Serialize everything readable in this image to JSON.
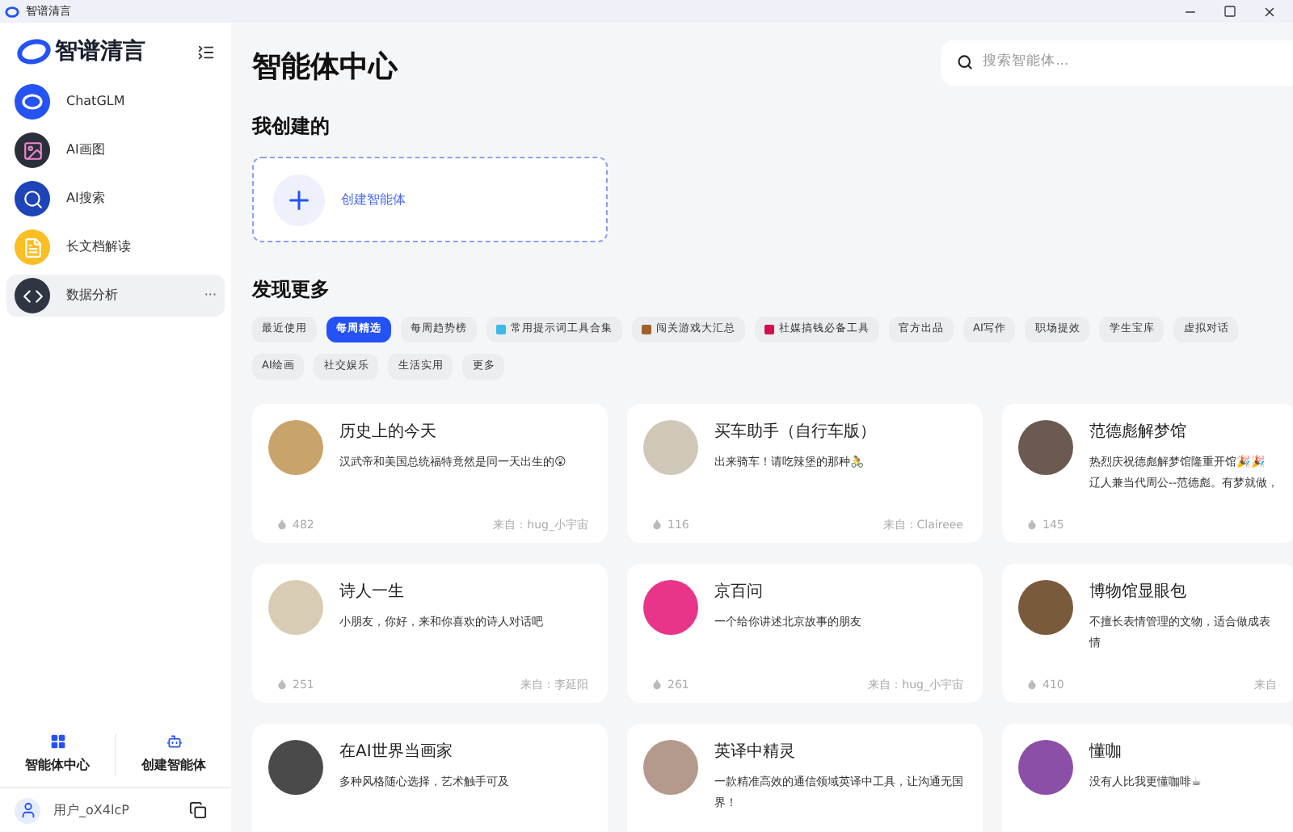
{
  "window": {
    "title": "智谱清言"
  },
  "sidebar": {
    "brand": "智谱清言",
    "items": [
      {
        "label": "ChatGLM",
        "kind": "chatglm",
        "selected": false
      },
      {
        "label": "AI画图",
        "kind": "draw",
        "selected": false
      },
      {
        "label": "AI搜索",
        "kind": "search",
        "selected": false
      },
      {
        "label": "长文档解读",
        "kind": "doc",
        "selected": false
      },
      {
        "label": "数据分析",
        "kind": "code",
        "selected": true,
        "more": "···"
      }
    ],
    "bottom_actions": [
      {
        "label": "智能体中心",
        "kind": "grid"
      },
      {
        "label": "创建智能体",
        "kind": "create"
      }
    ],
    "user": {
      "name": "用户_oX4lcP"
    }
  },
  "page": {
    "title": "智能体中心",
    "search": {
      "placeholder": "搜索智能体..."
    },
    "my_section": {
      "title": "我创建的",
      "create_label": "创建智能体"
    },
    "discover": {
      "title": "发现更多",
      "tags": [
        {
          "label": "最近使用",
          "selected": false
        },
        {
          "label": "每周精选",
          "selected": true
        },
        {
          "label": "每周趋势榜",
          "selected": false
        },
        {
          "label": "常用提示词工具合集",
          "selected": false,
          "color": "#3fb7e8"
        },
        {
          "label": "闯关游戏大汇总",
          "selected": false,
          "color": "#a0622a"
        },
        {
          "label": "社媒搞钱必备工具",
          "selected": false,
          "color": "#d0104c"
        },
        {
          "label": "官方出品",
          "selected": false
        },
        {
          "label": "AI写作",
          "selected": false
        },
        {
          "label": "职场提效",
          "selected": false
        },
        {
          "label": "学生宝库",
          "selected": false
        },
        {
          "label": "虚拟对话",
          "selected": false
        },
        {
          "label": "AI绘画",
          "selected": false
        },
        {
          "label": "社交娱乐",
          "selected": false
        },
        {
          "label": "生活实用",
          "selected": false
        },
        {
          "label": "更多",
          "selected": false
        }
      ],
      "cards": [
        {
          "title": "历史上的今天",
          "desc": "汉武帝和美国总统福特竟然是同一天出生的😲",
          "count": "482",
          "source": "来自：hug_小宇宙",
          "color": "#c9a46a"
        },
        {
          "title": "买车助手（自行车版）",
          "desc": "出来骑车！请吃辣堡的那种🚴",
          "count": "116",
          "source": "来自：Claireee",
          "color": "#cfc8b8"
        },
        {
          "title": "范德彪解梦馆",
          "desc": "热烈庆祝德彪解梦馆隆重开馆🎉🎉 辽人兼当代周公--范德彪。有梦就做，",
          "count": "145",
          "color": "#6b5a52"
        },
        {
          "title": "诗人一生",
          "desc": "小朋友，你好，来和你喜欢的诗人对话吧",
          "count": "251",
          "source": "来自：李延阳",
          "color": "#d8cdb4"
        },
        {
          "title": "京百问",
          "desc": "一个给你讲述北京故事的朋友",
          "count": "261",
          "source": "来自：hug_小宇宙",
          "color": "#e8358a"
        },
        {
          "title": "博物馆显眼包",
          "desc": "不擅长表情管理的文物，适合做成表情",
          "count": "410",
          "source": "来自",
          "color": "#7a5a3c"
        },
        {
          "title": "在AI世界当画家",
          "desc": "多种风格随心选择，艺术触手可及",
          "color": "#4a4a4a"
        },
        {
          "title": "英译中精灵",
          "desc": "一款精准高效的通信领域英译中工具，让沟通无国界！",
          "color": "#b49a8c"
        },
        {
          "title": "懂咖",
          "desc": "没有人比我更懂咖啡☕",
          "color": "#8b4fa8"
        }
      ]
    }
  }
}
